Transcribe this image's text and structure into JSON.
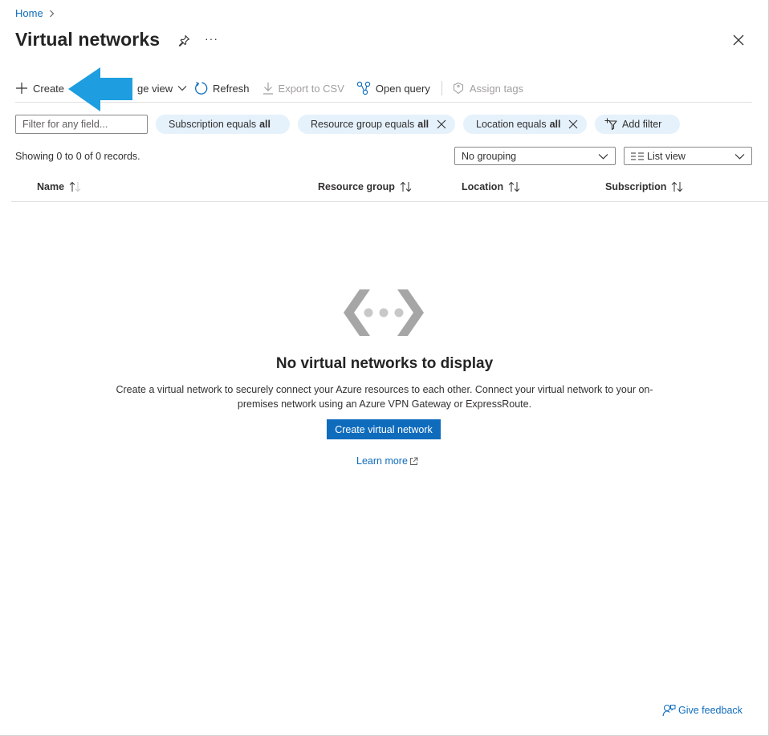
{
  "breadcrumb": {
    "home": "Home"
  },
  "header": {
    "title": "Virtual networks",
    "more": "···"
  },
  "toolbar": {
    "create": "Create",
    "manage_view": "ge view",
    "refresh": "Refresh",
    "export_csv": "Export to CSV",
    "open_query": "Open query",
    "assign_tags": "Assign tags"
  },
  "filters": {
    "placeholder": "Filter for any field...",
    "subscription": {
      "label": "Subscription equals",
      "value": "all"
    },
    "resource_group": {
      "label": "Resource group equals",
      "value": "all"
    },
    "location": {
      "label": "Location equals",
      "value": "all"
    },
    "add_filter": "Add filter"
  },
  "records": {
    "showing": "Showing 0 to 0 of 0 records.",
    "grouping": "No grouping",
    "view": "List view"
  },
  "columns": [
    "Name",
    "Resource group",
    "Location",
    "Subscription"
  ],
  "empty_state": {
    "title": "No virtual networks to display",
    "description": "Create a virtual network to securely connect your Azure resources to each other. Connect your virtual network to your on-premises network using an Azure VPN Gateway or ExpressRoute.",
    "button": "Create virtual network",
    "learn_more": "Learn more"
  },
  "footer": {
    "feedback": "Give feedback"
  },
  "colors": {
    "accent": "#0f6cbd",
    "pill_bg": "#e5f1fb",
    "arrow": "#1e9ee0"
  },
  "icons": [
    "chevron-right-icon",
    "pin-icon",
    "close-icon",
    "plus-icon",
    "chevron-down-icon",
    "refresh-icon",
    "download-icon",
    "query-icon",
    "tag-icon",
    "filter-add-icon",
    "list-icon",
    "sort-icon",
    "network-icon",
    "external-link-icon",
    "feedback-icon"
  ]
}
